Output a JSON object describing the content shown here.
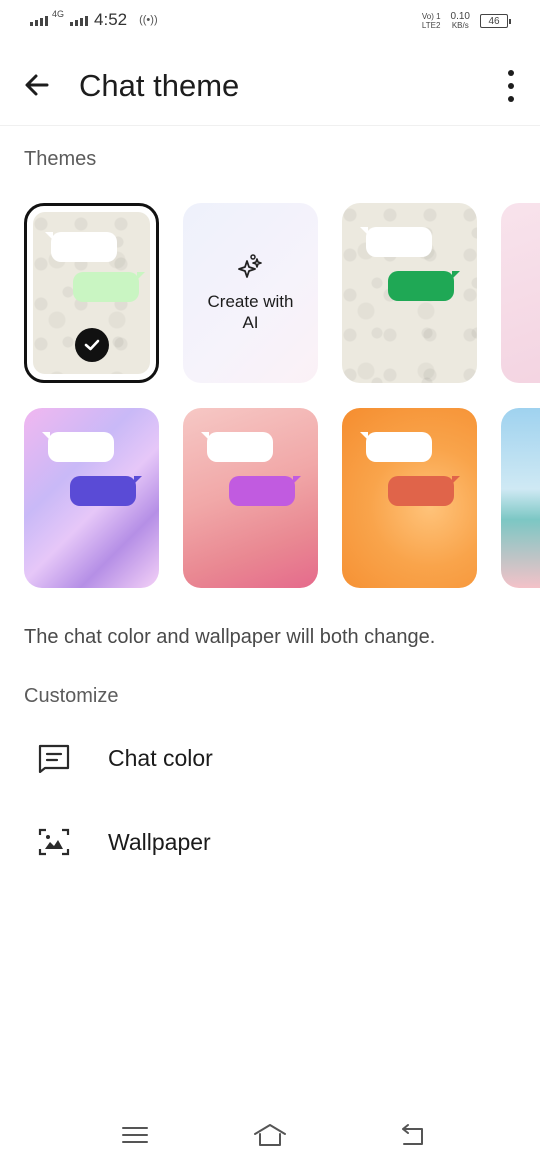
{
  "status_bar": {
    "network": "4G",
    "time": "4:52",
    "hotspot": "((•))",
    "volte_top": "Vo) 1",
    "volte_bottom": "LTE2",
    "speed_value": "0.10",
    "speed_unit": "KB/s",
    "battery": "46"
  },
  "app_bar": {
    "title": "Chat theme",
    "back_icon": "arrow-back-icon",
    "menu_icon": "more-vert-icon"
  },
  "themes_section": {
    "label": "Themes",
    "create_ai_label": "Create with AI",
    "tiles": [
      {
        "id": "default",
        "selected": true,
        "outgoing_color": "#c9f5c2",
        "background": "doodle"
      },
      {
        "id": "create-ai",
        "selected": false
      },
      {
        "id": "green",
        "selected": false,
        "outgoing_color": "#1fa855",
        "background": "doodle"
      },
      {
        "id": "pink-partial",
        "selected": false
      },
      {
        "id": "holo",
        "selected": false,
        "outgoing_color": "#5a4bd6"
      },
      {
        "id": "pink-flower",
        "selected": false,
        "outgoing_color": "#c15be0"
      },
      {
        "id": "orange",
        "selected": false,
        "outgoing_color": "#e0644a"
      },
      {
        "id": "sky-partial",
        "selected": false
      }
    ]
  },
  "description": "The chat color and wallpaper will both change.",
  "customize_section": {
    "label": "Customize",
    "items": [
      {
        "label": "Chat color",
        "icon": "chat-color-icon"
      },
      {
        "label": "Wallpaper",
        "icon": "wallpaper-icon"
      }
    ]
  },
  "nav_bar": {
    "icons": [
      "menu-icon",
      "home-icon",
      "back-nav-icon"
    ]
  }
}
